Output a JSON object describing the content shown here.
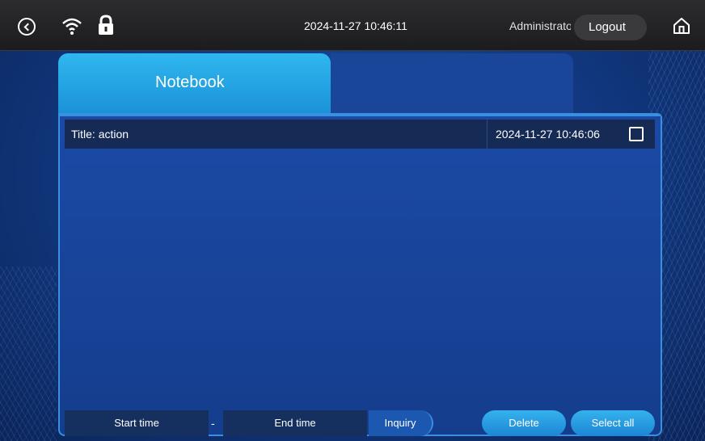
{
  "status_bar": {
    "datetime": "2024-11-27 10:46:11",
    "user": "Administrator",
    "logout_label": "Logout"
  },
  "tabs": [
    {
      "label": "Notebook",
      "active": true
    }
  ],
  "records": [
    {
      "title": "Title:  action",
      "time": "2024-11-27 10:46:06",
      "checked": false
    }
  ],
  "filter": {
    "start_placeholder": "Start time",
    "separator": "-",
    "end_placeholder": "End time",
    "inquiry_label": "Inquiry"
  },
  "actions": {
    "delete_label": "Delete",
    "select_all_label": "Select all"
  },
  "icons": [
    "back-icon",
    "wifi-icon",
    "lock-icon",
    "home-icon"
  ],
  "colors": {
    "accent": "#1a8fd6",
    "panel": "#1b4aa5",
    "row": "#152a55",
    "topbar": "#1c1c1e"
  }
}
